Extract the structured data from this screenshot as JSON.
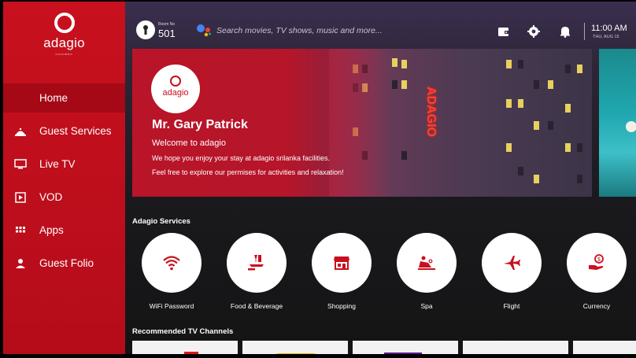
{
  "brand": {
    "name": "adagio",
    "tagline": "colombo",
    "colors": {
      "primary": "#c8101e",
      "sidebar_active": "#a50916",
      "text": "#ffffff"
    }
  },
  "sidebar": {
    "items": [
      {
        "label": "Home",
        "icon": "home",
        "active": true
      },
      {
        "label": "Guest Services",
        "icon": "room-service-icon",
        "active": false
      },
      {
        "label": "Live TV",
        "icon": "tv-icon",
        "active": false
      },
      {
        "label": "VOD",
        "icon": "play-icon",
        "active": false
      },
      {
        "label": "Apps",
        "icon": "grid-icon",
        "active": false
      },
      {
        "label": "Guest Folio",
        "icon": "person-icon",
        "active": false
      }
    ]
  },
  "topbar": {
    "room_label": "Room No",
    "room_number": "501",
    "search_placeholder": "Search movies, TV shows, music and more...",
    "time": "11:00 AM",
    "date": "THU, AUG 15",
    "icons": [
      "wallet-icon",
      "gear-icon",
      "bell-icon"
    ]
  },
  "hero": {
    "logo_text": "adagio",
    "guest_name": "Mr. Gary Patrick",
    "welcome": "Welcome to adagio",
    "line1": "We hope you enjoy your stay at adagio srilanka facilities.",
    "line2": "Feel free to explore our permises for activities and relaxation!",
    "neon_sign": "ADAGIO"
  },
  "services": {
    "title": "Adagio Services",
    "items": [
      {
        "label": "WiFi Password",
        "icon": "wifi-icon"
      },
      {
        "label": "Food & Beverage",
        "icon": "food-beverage-icon"
      },
      {
        "label": "Shopping",
        "icon": "shop-icon"
      },
      {
        "label": "Spa",
        "icon": "spa-icon"
      },
      {
        "label": "Flight",
        "icon": "airplane-icon"
      },
      {
        "label": "Currency",
        "icon": "currency-icon"
      }
    ]
  },
  "channels": {
    "title": "Recommended TV Channels"
  }
}
